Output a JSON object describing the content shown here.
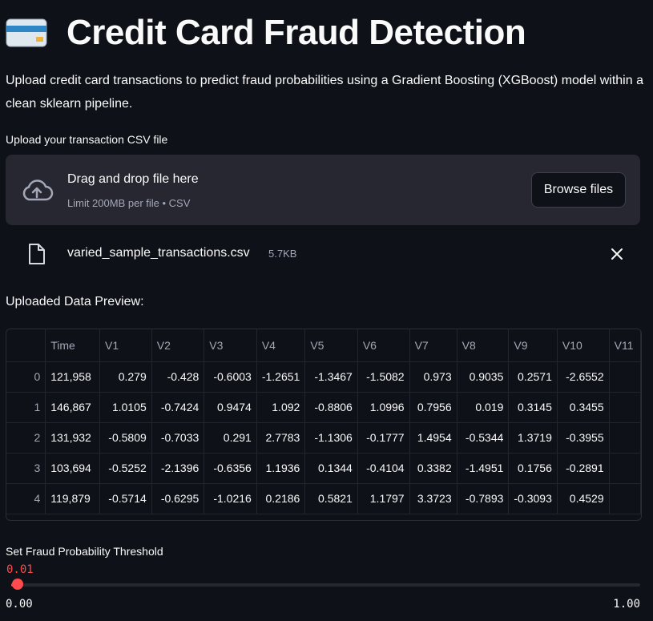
{
  "header": {
    "icon": "credit-card-icon",
    "title": "Credit Card Fraud Detection"
  },
  "description": "Upload credit card transactions to predict fraud probabilities using a Gradient Boosting (XGBoost) model within a clean sklearn pipeline.",
  "uploader": {
    "label": "Upload your transaction CSV file",
    "dropzone_title": "Drag and drop file here",
    "dropzone_subtitle": "Limit 200MB per file • CSV",
    "browse_label": "Browse files",
    "icon": "cloud-upload-icon"
  },
  "uploaded_file": {
    "name": "varied_sample_transactions.csv",
    "size": "5.7KB",
    "icon": "file-icon",
    "remove_icon": "close-icon"
  },
  "preview": {
    "title": "Uploaded Data Preview:",
    "columns": [
      "",
      "Time",
      "V1",
      "V2",
      "V3",
      "V4",
      "V5",
      "V6",
      "V7",
      "V8",
      "V9",
      "V10",
      "V11"
    ],
    "rows": [
      [
        "0",
        "121,958",
        "0.279",
        "-0.428",
        "-0.6003",
        "-1.2651",
        "-1.3467",
        "-1.5082",
        "0.973",
        "0.9035",
        "0.2571",
        "-2.6552",
        ""
      ],
      [
        "1",
        "146,867",
        "1.0105",
        "-0.7424",
        "0.9474",
        "1.092",
        "-0.8806",
        "1.0996",
        "0.7956",
        "0.019",
        "0.3145",
        "0.3455",
        ""
      ],
      [
        "2",
        "131,932",
        "-0.5809",
        "-0.7033",
        "0.291",
        "2.7783",
        "-1.1306",
        "-0.1777",
        "1.4954",
        "-0.5344",
        "1.3719",
        "-0.3955",
        ""
      ],
      [
        "3",
        "103,694",
        "-0.5252",
        "-2.1396",
        "-0.6356",
        "1.1936",
        "0.1344",
        "-0.4104",
        "0.3382",
        "-1.4951",
        "0.1756",
        "-0.2891",
        ""
      ],
      [
        "4",
        "119,879",
        "-0.5714",
        "-0.6295",
        "-1.0216",
        "0.2186",
        "0.5821",
        "1.1797",
        "3.3723",
        "-0.7893",
        "-0.3093",
        "0.4529",
        ""
      ]
    ]
  },
  "slider": {
    "label": "Set Fraud Probability Threshold",
    "value": "0.01",
    "value_number": 0.01,
    "min": "0.00",
    "max": "1.00",
    "min_number": 0,
    "max_number": 1,
    "accent": "#ff4b4b"
  },
  "colors": {
    "background": "#0e1117",
    "surface": "#262730",
    "text": "#fafafa",
    "muted": "#a3a8b8",
    "accent": "#ff4b4b"
  }
}
